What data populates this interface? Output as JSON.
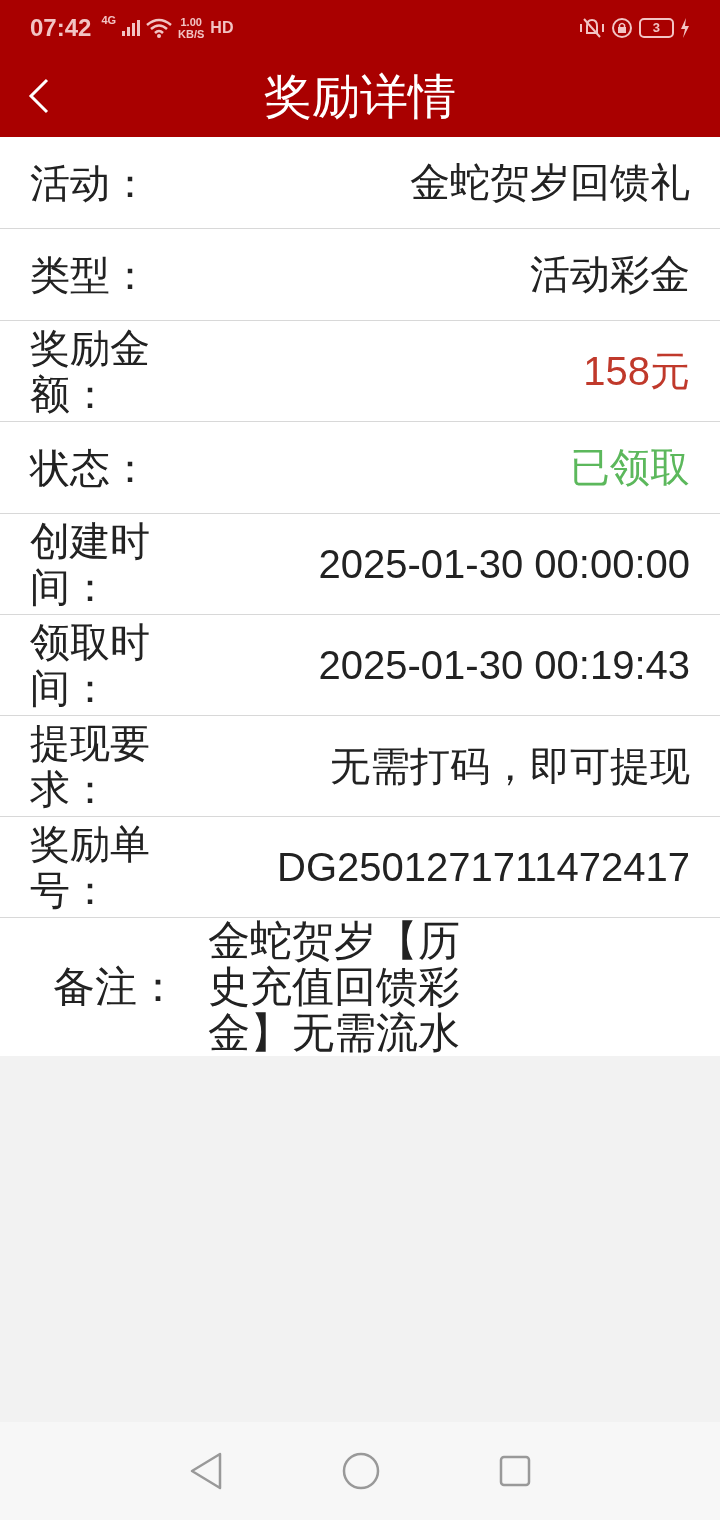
{
  "status_bar": {
    "time": "07:42",
    "network": "4G",
    "speed_value": "1.00",
    "speed_unit": "KB/S",
    "hd": "HD",
    "battery": "3"
  },
  "header": {
    "title": "奖励详情"
  },
  "rows": [
    {
      "label": "活动：",
      "value": "金蛇贺岁回馈礼",
      "kind": "plain"
    },
    {
      "label": "类型：",
      "value": "活动彩金",
      "kind": "plain"
    },
    {
      "label": "奖励金额：",
      "value": "158元",
      "kind": "plain",
      "color": "#c0392b"
    },
    {
      "label": "状态：",
      "value": "已领取",
      "kind": "plain",
      "color": "#5cb85c"
    },
    {
      "label": "创建时间：",
      "value": "2025-01-30 00:00:00",
      "kind": "plain"
    },
    {
      "label": "领取时间：",
      "value": "2025-01-30 00:19:43",
      "kind": "plain"
    },
    {
      "label": "提现要求：",
      "value": "无需打码，即可提现",
      "kind": "plain"
    },
    {
      "label": "奖励单号：",
      "value": "DG2501271711472417",
      "kind": "plain"
    },
    {
      "label": "备注：",
      "value": "金蛇贺岁【历史充值回馈彩金】无需流水",
      "kind": "note"
    }
  ]
}
